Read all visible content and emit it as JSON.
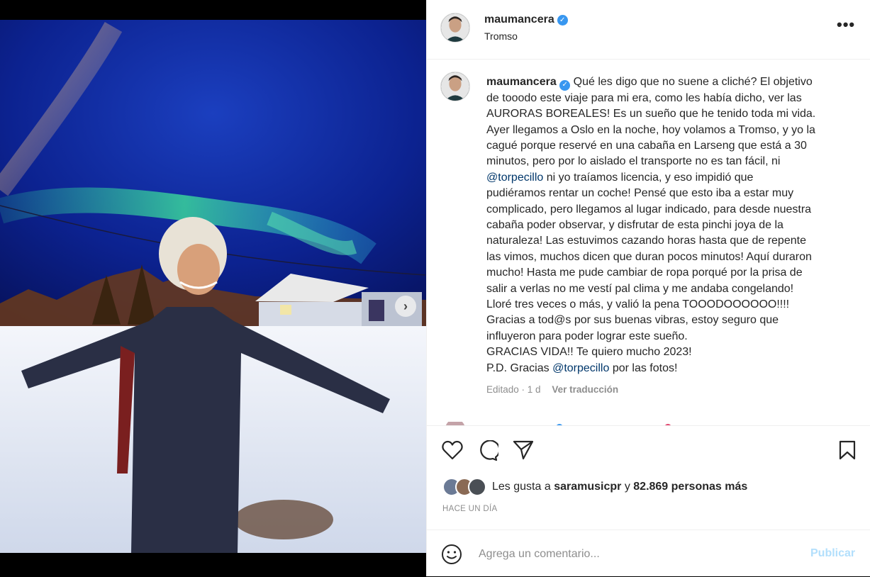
{
  "post": {
    "username": "maumancera",
    "location": "Tromso",
    "verified": true
  },
  "caption": {
    "username": "maumancera",
    "lines": [
      "Qué les digo que no suene a cliché? El objetivo",
      "de tooodo este viaje para mi era, como les había dicho, ver las",
      "AURORAS BOREALES! Es un sueño que he tenido toda mi vida.",
      "Ayer llegamos a Oslo en la noche, hoy volamos a Tromso, y yo la",
      "cagué porque reservé en una cabaña en Larseng que está a 30",
      "minutos, pero por lo aislado el transporte no es tan fácil, ni",
      "ni yo traíamos licencia, y eso impidió que",
      "pudiéramos rentar un coche! Pensé que esto iba a estar muy",
      "complicado, pero llegamos al lugar indicado, para desde nuestra",
      "cabaña poder observar, y disfrutar de esta pinchi joya de la",
      "naturaleza! Las estuvimos cazando horas hasta que de repente",
      "las vimos, muchos dicen que duran pocos minutos! Aquí duraron",
      "mucho! Hasta me pude cambiar de ropa porqué por la prisa de",
      "salir a verlas no me vestí pal clima y me andaba congelando!",
      "Lloré tres veces o más, y valió la pena TOOODOOOOOO!!!!",
      "Gracias a tod@s por sus buenas vibras, estoy seguro que",
      "influyeron para poder lograr este sueño.",
      "GRACIAS VIDA!! Te quiero mucho 2023!",
      "P.D. Gracias",
      "por las fotos!"
    ],
    "mention": "@torpecillo",
    "edited": "Editado · 1 d",
    "translate": "Ver traducción"
  },
  "likes": {
    "prefix": "Les gusta a",
    "user": "saramusicpr",
    "joiner": "y",
    "count": "82.869 personas más"
  },
  "time_ago": "HACE UN DÍA",
  "composer": {
    "placeholder": "Agrega un comentario...",
    "publish": "Publicar"
  },
  "carousel": {
    "dot_count": 10,
    "active_index": 0
  },
  "colors": {
    "text": "#262626",
    "secondary": "#8e8e8e",
    "link": "#00376b",
    "verified": "#3897f0",
    "publish_disabled": "#b2dffc"
  }
}
